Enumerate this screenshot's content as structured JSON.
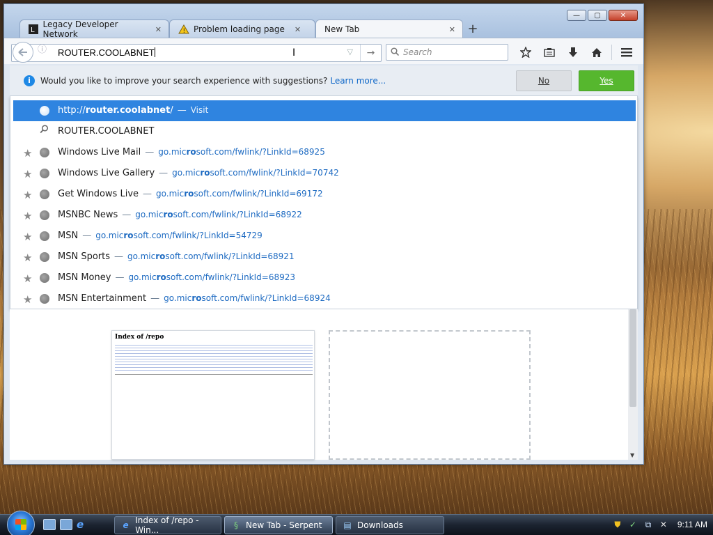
{
  "browser": {
    "tabs": [
      {
        "label": "Legacy Developer Network",
        "icon": "ldn-logo-icon",
        "active": false
      },
      {
        "label": "Problem loading page",
        "icon": "warning-icon",
        "active": false
      },
      {
        "label": "New Tab",
        "icon": "",
        "active": true
      }
    ],
    "new_tab_symbol": "+",
    "window_controls": {
      "minimize": "—",
      "maximize": "▢",
      "close": "✕"
    },
    "url": "ROUTER.COOLABNET",
    "search_placeholder": "Search",
    "toolbar_icons": [
      "bookmark-star-icon",
      "reading-list-icon",
      "download-icon",
      "home-icon",
      "menu-icon"
    ]
  },
  "notification": {
    "message": "Would you like to improve your search experience with suggestions?",
    "link": "Learn more...",
    "no_label": "No",
    "yes_label": "Yes"
  },
  "suggestions": {
    "visit_row": {
      "prefix": "http://",
      "host": "router.coolabnet",
      "suffix": "/",
      "dash": "—",
      "action": "Visit"
    },
    "search_row": {
      "text": "ROUTER.COOLABNET"
    },
    "bookmarks": [
      {
        "title": "Windows Live Mail",
        "url_pre": "go.mic",
        "url_bold": "ro",
        "url_post": "soft.com/fwlink/?LinkId=68925"
      },
      {
        "title": "Windows Live Gallery",
        "url_pre": "go.mic",
        "url_bold": "ro",
        "url_post": "soft.com/fwlink/?LinkId=70742"
      },
      {
        "title": "Get Windows Live",
        "url_pre": "go.mic",
        "url_bold": "ro",
        "url_post": "soft.com/fwlink/?LinkId=69172"
      },
      {
        "title": "MSNBC News",
        "url_pre": "go.mic",
        "url_bold": "ro",
        "url_post": "soft.com/fwlink/?LinkId=68922"
      },
      {
        "title": "MSN",
        "url_pre": "go.mic",
        "url_bold": "ro",
        "url_post": "soft.com/fwlink/?LinkId=54729"
      },
      {
        "title": "MSN Sports",
        "url_pre": "go.mic",
        "url_bold": "ro",
        "url_post": "soft.com/fwlink/?LinkId=68921"
      },
      {
        "title": "MSN Money",
        "url_pre": "go.mic",
        "url_bold": "ro",
        "url_post": "soft.com/fwlink/?LinkId=68923"
      },
      {
        "title": "MSN Entertainment",
        "url_pre": "go.mic",
        "url_bold": "ro",
        "url_post": "soft.com/fwlink/?LinkId=68924"
      }
    ],
    "dash": "—"
  },
  "content": {
    "thumbnail_title": "Index of /repo"
  },
  "taskbar": {
    "tasks": [
      {
        "label": "Index of /repo - Win...",
        "icon": "ie-icon",
        "active": false
      },
      {
        "label": "New Tab - Serpent",
        "icon": "serpent-icon",
        "active": true
      },
      {
        "label": "Downloads",
        "icon": "downloads-icon",
        "active": false
      }
    ],
    "clock": "9:11 AM"
  },
  "colors": {
    "accent_selection": "#2f84e0",
    "yes_button": "#56b72e",
    "link": "#1e6bc2"
  }
}
